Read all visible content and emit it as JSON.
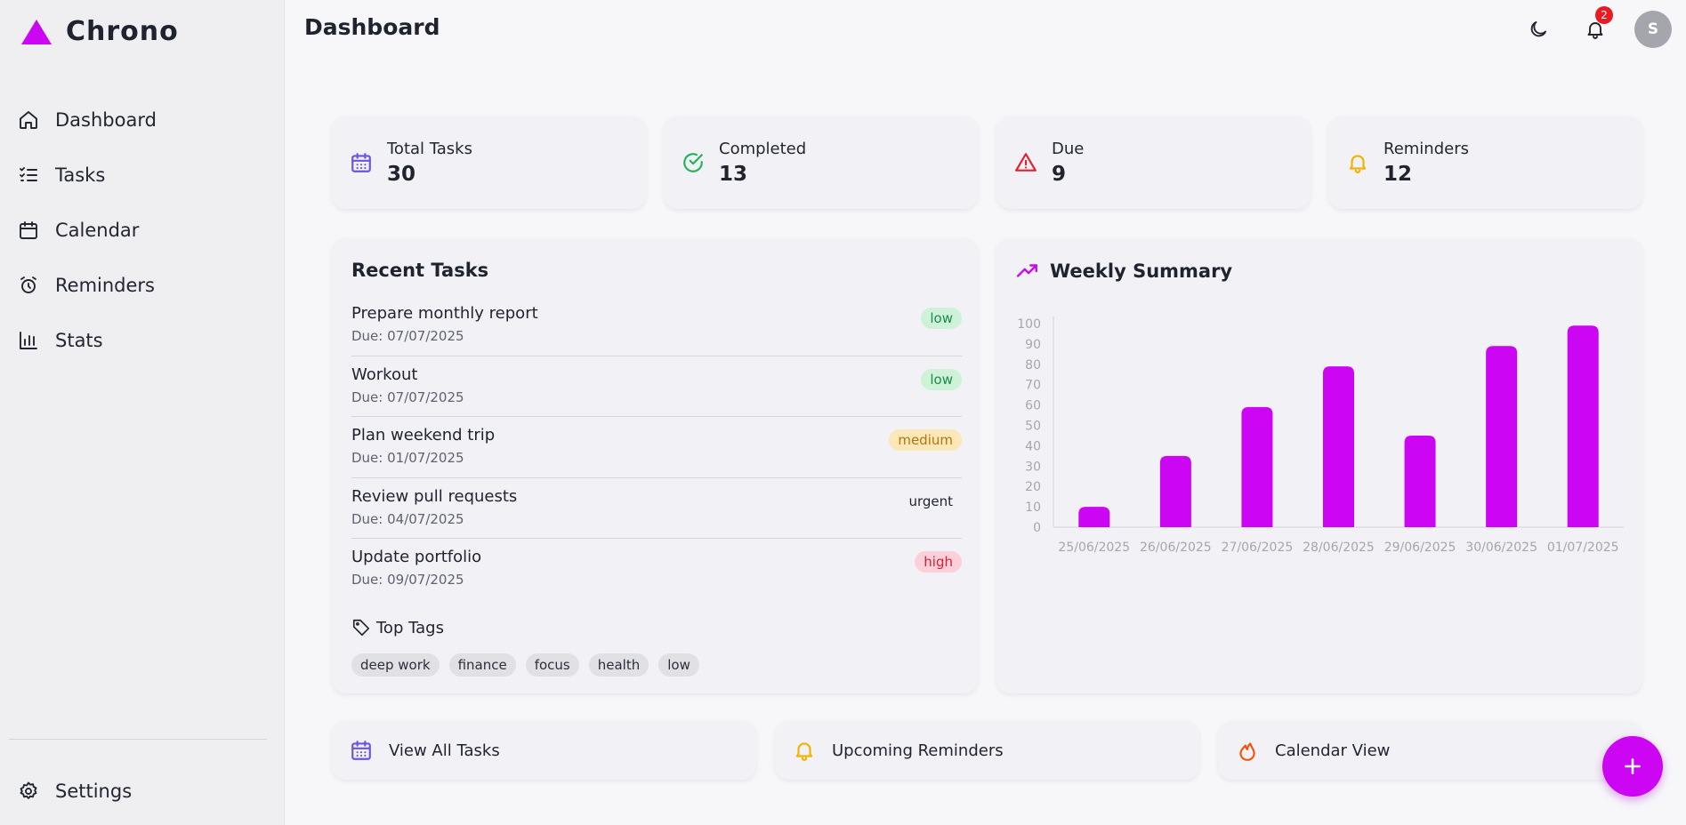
{
  "app": {
    "name": "Chrono",
    "brand_color": "#cc05f2"
  },
  "sidebar": {
    "items": [
      {
        "label": "Dashboard",
        "icon": "home-icon"
      },
      {
        "label": "Tasks",
        "icon": "list-checks-icon"
      },
      {
        "label": "Calendar",
        "icon": "calendar-icon"
      },
      {
        "label": "Reminders",
        "icon": "alarm-clock-icon"
      },
      {
        "label": "Stats",
        "icon": "bar-chart-icon"
      }
    ],
    "settings_label": "Settings"
  },
  "header": {
    "title": "Dashboard",
    "notifications_count": "2",
    "avatar_initial": "S"
  },
  "stats": [
    {
      "label": "Total Tasks",
      "value": "30",
      "icon": "calendar-icon",
      "color": "#6b55e0"
    },
    {
      "label": "Completed",
      "value": "13",
      "icon": "check-circle-icon",
      "color": "#22b35a"
    },
    {
      "label": "Due",
      "value": "9",
      "icon": "alert-triangle-icon",
      "color": "#e0202f"
    },
    {
      "label": "Reminders",
      "value": "12",
      "icon": "bell-icon",
      "color": "#f0b400"
    }
  ],
  "recent_tasks": {
    "title": "Recent Tasks",
    "tasks": [
      {
        "title": "Prepare monthly report",
        "due": "Due: 07/07/2025",
        "priority": "low"
      },
      {
        "title": "Workout",
        "due": "Due: 07/07/2025",
        "priority": "low"
      },
      {
        "title": "Plan weekend trip",
        "due": "Due: 01/07/2025",
        "priority": "medium"
      },
      {
        "title": "Review pull requests",
        "due": "Due: 04/07/2025",
        "priority": "urgent"
      },
      {
        "title": "Update portfolio",
        "due": "Due: 09/07/2025",
        "priority": "high"
      }
    ],
    "tags_title": "Top Tags",
    "tags": [
      "deep work",
      "finance",
      "focus",
      "health",
      "low"
    ]
  },
  "weekly_summary": {
    "title": "Weekly Summary"
  },
  "chart_data": {
    "type": "bar",
    "title": "Weekly Summary",
    "categories": [
      "25/06/2025",
      "26/06/2025",
      "27/06/2025",
      "28/06/2025",
      "29/06/2025",
      "30/06/2025",
      "01/07/2025"
    ],
    "values": [
      10,
      35,
      59,
      79,
      45,
      89,
      99
    ],
    "yticks": [
      0,
      10,
      20,
      30,
      40,
      50,
      60,
      70,
      80,
      90,
      100
    ],
    "ylim": [
      0,
      100
    ],
    "bar_color": "#cc05f2",
    "grid": false
  },
  "actions": [
    {
      "label": "View All Tasks",
      "icon": "calendar-icon",
      "color": "#6b55e0"
    },
    {
      "label": "Upcoming Reminders",
      "icon": "bell-icon",
      "color": "#f0b400"
    },
    {
      "label": "Calendar View",
      "icon": "flame-icon",
      "color": "#f2540e"
    }
  ]
}
